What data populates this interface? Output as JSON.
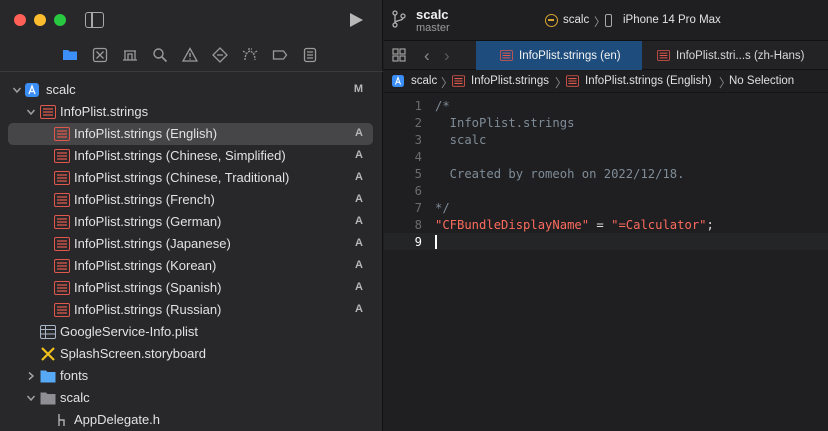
{
  "colors": {
    "accent_tab": "#1e4d7d",
    "string": "#fc6a5d",
    "comment": "#7f8c98",
    "strings_icon": "#e0574c",
    "folder": "#57a9f5",
    "app_icon": "#3a8ef6"
  },
  "toolbar": {
    "project": "scalc",
    "branch": "master",
    "scheme": "scalc",
    "scheme_separator": "〉",
    "device": "iPhone 14 Pro Max"
  },
  "navigator": {
    "icons": [
      "folder-icon",
      "source-control-icon",
      "symbol-icon",
      "find-icon",
      "issue-icon",
      "test-icon",
      "debug-icon",
      "breakpoint-icon",
      "report-icon"
    ]
  },
  "tree": {
    "rows": [
      {
        "label": "scalc",
        "badge": "M",
        "icon": "app-icon"
      },
      {
        "label": "InfoPlist.strings",
        "badge": "",
        "icon": "strings-icon"
      },
      {
        "label": "InfoPlist.strings (English)",
        "badge": "A",
        "icon": "strings-icon"
      },
      {
        "label": "InfoPlist.strings (Chinese, Simplified)",
        "badge": "A",
        "icon": "strings-icon"
      },
      {
        "label": "InfoPlist.strings (Chinese, Traditional)",
        "badge": "A",
        "icon": "strings-icon"
      },
      {
        "label": "InfoPlist.strings (French)",
        "badge": "A",
        "icon": "strings-icon"
      },
      {
        "label": "InfoPlist.strings (German)",
        "badge": "A",
        "icon": "strings-icon"
      },
      {
        "label": "InfoPlist.strings (Japanese)",
        "badge": "A",
        "icon": "strings-icon"
      },
      {
        "label": "InfoPlist.strings (Korean)",
        "badge": "A",
        "icon": "strings-icon"
      },
      {
        "label": "InfoPlist.strings (Spanish)",
        "badge": "A",
        "icon": "strings-icon"
      },
      {
        "label": "InfoPlist.strings (Russian)",
        "badge": "A",
        "icon": "strings-icon"
      },
      {
        "label": "GoogleService-Info.plist",
        "badge": "",
        "icon": "plist-icon"
      },
      {
        "label": "SplashScreen.storyboard",
        "badge": "",
        "icon": "storyboard-icon"
      },
      {
        "label": "fonts",
        "badge": "",
        "icon": "folder-icon"
      },
      {
        "label": "scalc",
        "badge": "",
        "icon": "folder-icon"
      },
      {
        "label": "AppDelegate.h",
        "badge": "",
        "icon": "header-icon"
      }
    ]
  },
  "tabs": [
    {
      "label": "InfoPlist.strings (en)",
      "active": true
    },
    {
      "label": "InfoPlist.stri...s (zh-Hans)",
      "active": false
    }
  ],
  "jumpbar": {
    "project": "scalc",
    "group": "InfoPlist.strings",
    "file": "InfoPlist.strings (English)",
    "selection": "No Selection",
    "separator": "〉"
  },
  "editor": {
    "line_numbers": [
      "1",
      "2",
      "3",
      "4",
      "5",
      "6",
      "7",
      "8",
      "9"
    ],
    "line1": "/*",
    "line2": "  InfoPlist.strings",
    "line3": "  scalc",
    "line5": "  Created by romeoh on 2022/12/18.",
    "line7": "*/",
    "line8_key": "\"CFBundleDisplayName\"",
    "line8_eq": " = ",
    "line8_value": "\"=Calculator\"",
    "line8_end": ";"
  }
}
